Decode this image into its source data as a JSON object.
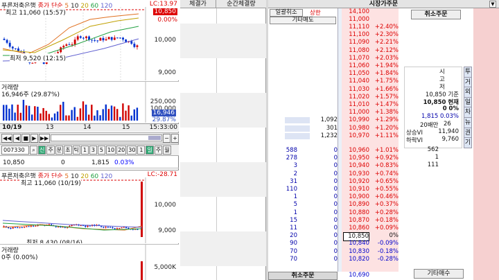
{
  "upper_chart": {
    "title": "푸른저축은행",
    "ma_legend": {
      "label": "종가 단순",
      "values": [
        "5",
        "10",
        "20",
        "60",
        "120"
      ]
    },
    "lc_label": "LC:13.97",
    "high_note": "최고 11,060 (15:57)",
    "low_note": "최저 9,520 (12:15)",
    "price_tag": "10,850",
    "pct_tag": "0.00%",
    "y_ticks": [
      "10,000",
      "9,000"
    ],
    "volume_title": "거래량",
    "volume_value": "16,946주 (29.87%)",
    "vol_ticks": [
      "250,000",
      "100,000"
    ],
    "vol_tag": "16,946",
    "vol_pct": "29.87%",
    "x_labels": [
      "10/19",
      "13",
      "14",
      "15",
      "15:33:00"
    ],
    "colors": {
      "up": "#d00000",
      "down": "#0030d0",
      "ma5": "#e07020",
      "ma20": "#20a040",
      "ma60": "#6060d0"
    }
  },
  "toolbar": {
    "code": "007330",
    "buttons": [
      "신",
      "주",
      "분",
      "초",
      "틱",
      "1",
      "3",
      "5",
      "10",
      "20",
      "30",
      "1",
      "일",
      "주",
      "월"
    ]
  },
  "quote_row": {
    "price": "10,850",
    "change": "0",
    "volume": "1,815",
    "rate": "0.03%"
  },
  "lower_chart": {
    "title": "푸른저축은행",
    "ma_legend": {
      "label": "종가 단순",
      "values": [
        "5",
        "10",
        "20",
        "60",
        "120"
      ]
    },
    "lc_label": "LC:-28.71",
    "high_note": "최고 11,060 (10/19)",
    "low_note": "최저 8,430 (08/16)",
    "y_ticks": [
      "10,000",
      "9,000"
    ],
    "volume_title": "거래량",
    "volume_value": "0주 (0.00%)",
    "vol_ticks": [
      "5,000K"
    ]
  },
  "trades": {
    "headers": [
      "체결가",
      "순간체결량"
    ]
  },
  "orderbook": {
    "top_header": "시장가주문",
    "buttons": {
      "bulk_cancel": "일괄취소",
      "upper_limit": "상한",
      "other_sell": "기타매도",
      "cancel_order": "취소주문",
      "other_buy": "기타매수",
      "cancel_order_bottom": "취소주문"
    },
    "upper_price": "14,100",
    "base_price": "11,000",
    "asks": [
      {
        "price": "11,110",
        "rate": "+2.40%"
      },
      {
        "price": "11,100",
        "rate": "+2.30%"
      },
      {
        "price": "11,090",
        "rate": "+2.21%"
      },
      {
        "price": "11,080",
        "rate": "+2.12%"
      },
      {
        "price": "11,070",
        "rate": "+2.03%"
      },
      {
        "price": "11,060",
        "rate": "+1.94%"
      },
      {
        "price": "11,050",
        "rate": "+1.84%"
      },
      {
        "price": "11,040",
        "rate": "+1.75%"
      },
      {
        "price": "11,030",
        "rate": "+1.66%"
      },
      {
        "price": "11,020",
        "rate": "+1.57%"
      },
      {
        "price": "11,010",
        "rate": "+1.47%"
      },
      {
        "price": "11,000",
        "rate": "+1.38%"
      },
      {
        "price": "10,990",
        "rate": "+1.29%",
        "qty": "1,092"
      },
      {
        "price": "10,980",
        "rate": "+1.20%",
        "qty": "301"
      },
      {
        "price": "10,970",
        "rate": "+1.11%",
        "qty": "1,232"
      }
    ],
    "bids": [
      {
        "price": "10,960",
        "rate": "+1.01%",
        "ql": "588",
        "qr": "0"
      },
      {
        "price": "10,950",
        "rate": "+0.92%",
        "ql": "278",
        "qr": "0"
      },
      {
        "price": "10,940",
        "rate": "+0.83%",
        "ql": "3",
        "qr": "0"
      },
      {
        "price": "10,930",
        "rate": "+0.74%",
        "ql": "2",
        "qr": "0"
      },
      {
        "price": "10,920",
        "rate": "+0.65%",
        "ql": "31",
        "qr": "0"
      },
      {
        "price": "10,910",
        "rate": "+0.55%",
        "ql": "110",
        "qr": "0"
      },
      {
        "price": "10,900",
        "rate": "+0.46%",
        "ql": "1",
        "qr": "0"
      },
      {
        "price": "10,890",
        "rate": "+0.37%",
        "ql": "5",
        "qr": "0"
      },
      {
        "price": "10,880",
        "rate": "+0.28%",
        "ql": "1",
        "qr": "0"
      },
      {
        "price": "10,870",
        "rate": "+0.18%",
        "ql": "15",
        "qr": "0"
      },
      {
        "price": "10,860",
        "rate": "+0.09%",
        "ql": "11",
        "qr": "0"
      },
      {
        "price": "10,850",
        "rate": "0%",
        "ql": "20",
        "qr": "0"
      },
      {
        "price": "10,840",
        "rate": "-0.09%",
        "ql": "90",
        "qr": "0"
      },
      {
        "price": "10,830",
        "rate": "-0.18%",
        "ql": "70",
        "qr": "0"
      },
      {
        "price": "10,820",
        "rate": "-0.28%",
        "ql": "70",
        "qr": "0"
      }
    ],
    "bottom_price": "10,690",
    "info": {
      "labels": [
        "시",
        "고",
        "저"
      ],
      "base_label_value": "10,850 기준",
      "current": "10,850 현재",
      "zero_row": "0 0%",
      "qty_row": "1,815 0.03%",
      "ma20_label": "20배만",
      "ma20_value": "26",
      "rise_label": "상승VI",
      "rise_value": "11,940",
      "fall_label": "하락VI",
      "fall_value": "9,760",
      "bid_side": [
        "562",
        "1",
        "111"
      ]
    },
    "side_buttons": [
      "투",
      "거",
      "외",
      "일",
      "차",
      "뉴",
      "권",
      "기"
    ]
  }
}
